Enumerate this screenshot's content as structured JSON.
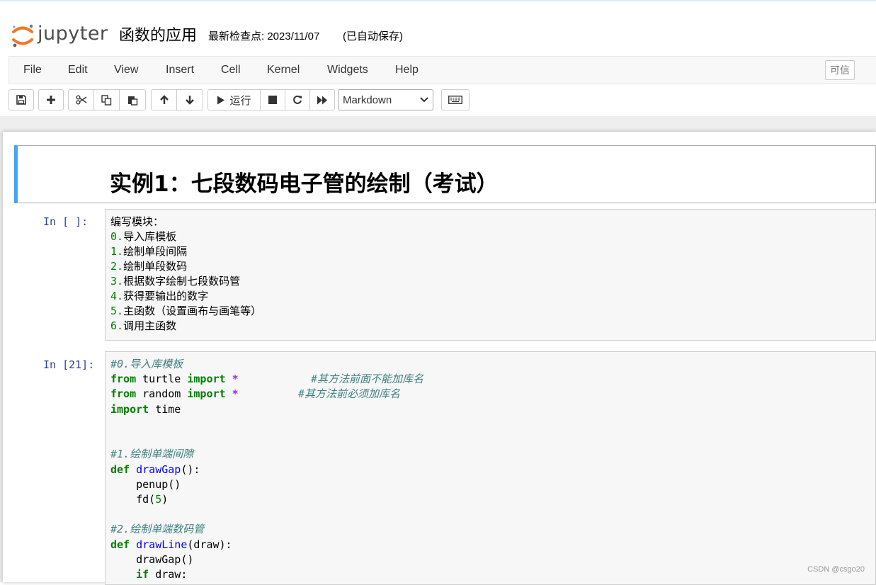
{
  "header": {
    "logo_text": "jupyter",
    "notebook_title": "函数的应用",
    "checkpoint": "最新检查点: 2023/11/07",
    "autosave": "(已自动保存)"
  },
  "menubar": {
    "items": [
      "File",
      "Edit",
      "View",
      "Insert",
      "Cell",
      "Kernel",
      "Widgets",
      "Help"
    ],
    "trusted": "可信"
  },
  "toolbar": {
    "run_label": "运行",
    "cell_type": "Markdown"
  },
  "cells": {
    "heading": "实例1：七段数码电子管的绘制（考试）",
    "cell1": {
      "prompt": "In [ ]:",
      "title": "编写模块：",
      "items": [
        {
          "n": "0.",
          "t": "导入库模板"
        },
        {
          "n": "1.",
          "t": "绘制单段间隔"
        },
        {
          "n": "2.",
          "t": "绘制单段数码"
        },
        {
          "n": "3.",
          "t": "根据数字绘制七段数码管"
        },
        {
          "n": "4.",
          "t": "获得要输出的数字"
        },
        {
          "n": "5.",
          "t": "主函数（设置画布与画笔等）"
        },
        {
          "n": "6.",
          "t": "调用主函数"
        }
      ]
    },
    "cell2": {
      "prompt": "In [21]:",
      "comment0": "#0.导入库模板",
      "from1": "from",
      "mod1": " turtle ",
      "import1": "import",
      "star1": " *",
      "comment1": "#其方法前面不能加库名",
      "from2": "from",
      "mod2": " random ",
      "import2": "import",
      "star2": " *",
      "comment2": "#其方法前必须加库名",
      "import3": "import",
      "mod3": " time",
      "comment3": "#1.绘制单端间隙",
      "def1": "def",
      "fname1": "drawGap",
      "sig1": "():",
      "body1a": "    penup()",
      "body1b_pre": "    fd(",
      "body1b_num": "5",
      "body1b_post": ")",
      "comment4": "#2.绘制单端数码管",
      "def2": "def",
      "fname2": "drawLine",
      "sig2": "(draw):",
      "body2a": "    drawGap()",
      "body2b_kw": "if",
      "body2b_rest": " draw:"
    }
  },
  "watermark": "CSDN @csgo20"
}
